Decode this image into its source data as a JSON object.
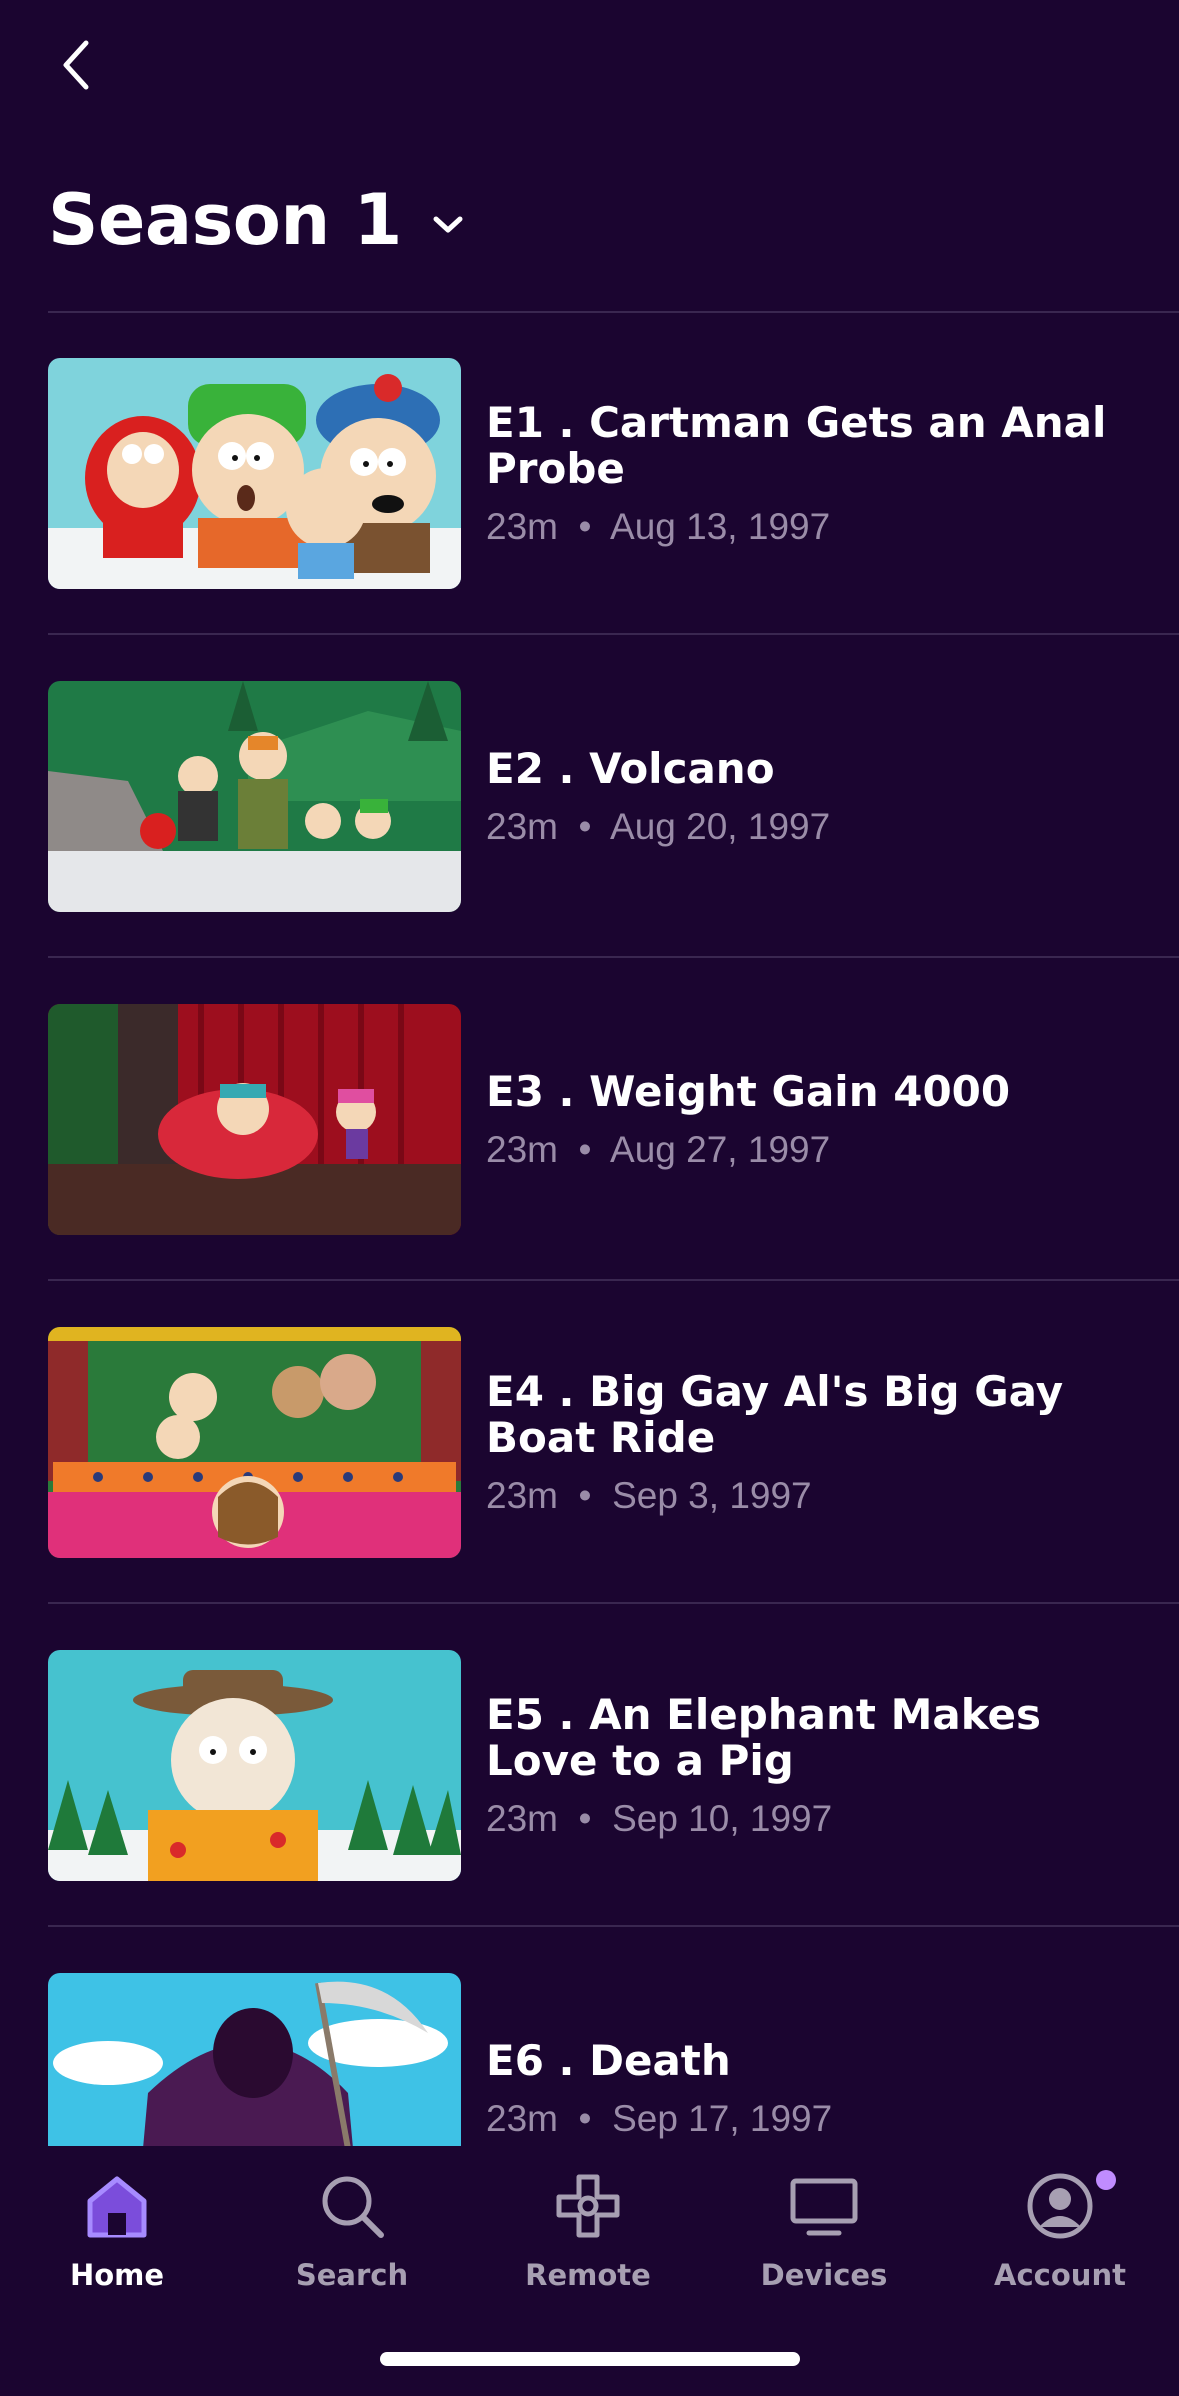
{
  "header": {
    "season_title": "Season 1"
  },
  "episodes": [
    {
      "title": "E1 . Cartman Gets an Anal Probe",
      "duration": "23m",
      "date": "Aug 13, 1997"
    },
    {
      "title": "E2 . Volcano",
      "duration": "23m",
      "date": "Aug 20, 1997"
    },
    {
      "title": "E3 . Weight Gain 4000",
      "duration": "23m",
      "date": "Aug 27, 1997"
    },
    {
      "title": "E4 . Big Gay Al's Big Gay Boat Ride",
      "duration": "23m",
      "date": "Sep 3, 1997"
    },
    {
      "title": "E5 . An Elephant Makes Love to a Pig",
      "duration": "23m",
      "date": "Sep 10, 1997"
    },
    {
      "title": "E6 . Death",
      "duration": "23m",
      "date": "Sep 17, 1997"
    }
  ],
  "tabbar": {
    "items": [
      {
        "label": "Home",
        "icon": "home-icon",
        "active": true
      },
      {
        "label": "Search",
        "icon": "search-icon",
        "active": false
      },
      {
        "label": "Remote",
        "icon": "remote-icon",
        "active": false
      },
      {
        "label": "Devices",
        "icon": "tv-icon",
        "active": false
      },
      {
        "label": "Account",
        "icon": "account-icon",
        "active": false,
        "notification": true
      }
    ]
  },
  "colors": {
    "background": "#1b0530",
    "accent": "#9b6bff",
    "notification_dot": "#c08cff",
    "text_secondary": "#9a8ca8",
    "divider": "#3a2750"
  }
}
